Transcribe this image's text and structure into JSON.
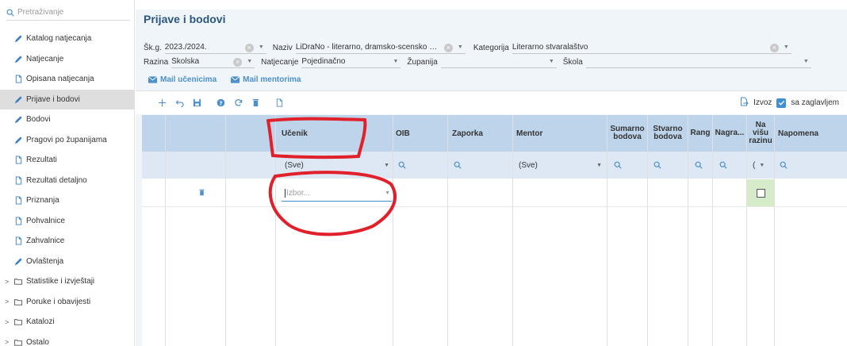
{
  "sidebar": {
    "search_placeholder": "Pretraživanje",
    "items": [
      {
        "label": "Katalog natjecanja",
        "icon": "pencil-icon"
      },
      {
        "label": "Natjecanje",
        "icon": "pencil-icon"
      },
      {
        "label": "Opisana natjecanja",
        "icon": "document-icon"
      },
      {
        "label": "Prijave i bodovi",
        "icon": "pencil-icon",
        "active": true
      },
      {
        "label": "Bodovi",
        "icon": "pencil-icon"
      },
      {
        "label": "Pragovi po županijama",
        "icon": "pencil-icon"
      },
      {
        "label": "Rezultati",
        "icon": "document-icon"
      },
      {
        "label": "Rezultati detaljno",
        "icon": "document-icon"
      },
      {
        "label": "Priznanja",
        "icon": "document-icon"
      },
      {
        "label": "Pohvalnice",
        "icon": "document-icon"
      },
      {
        "label": "Zahvalnice",
        "icon": "document-icon"
      },
      {
        "label": "Ovlaštenja",
        "icon": "pencil-icon"
      }
    ],
    "folders": [
      {
        "label": "Statistike i izvještaji"
      },
      {
        "label": "Poruke i obavijesti"
      },
      {
        "label": "Katalozi"
      },
      {
        "label": "Ostalo"
      }
    ]
  },
  "page": {
    "title": "Prijave i bodovi"
  },
  "filters": {
    "skg_label": "Šk.g.",
    "skg_value": "2023./2024.",
    "naziv_label": "Naziv",
    "naziv_value": "LiDraNo - literarno, dramsko-scensko i novi...",
    "kategorija_label": "Kategorija",
    "kategorija_value": "Literarno stvaralaštvo",
    "razina_label": "Razina",
    "razina_value": "Školska",
    "natjecanje_label": "Natjecanje",
    "natjecanje_value": "Pojedinačno",
    "zupanija_label": "Županija",
    "zupanija_value": "",
    "skola_label": "Škola",
    "skola_value": ""
  },
  "mail": {
    "students": "Mail učenicima",
    "mentors": "Mail mentorima"
  },
  "toolbar": {
    "export_label": "Izvoz",
    "headers_label": "sa zaglavljem",
    "headers_checked": true
  },
  "grid": {
    "columns": {
      "ucenik": "Učenik",
      "oib": "OIB",
      "zaporka": "Zaporka",
      "mentor": "Mentor",
      "sumarno_bodova": "Sumarno bodova",
      "stvarno_bodova": "Stvarno bodova",
      "rang": "Rang",
      "nagrada": "Nagra...",
      "na_visu_razinu": "Na višu razinu",
      "napomena": "Napomena"
    },
    "filter_row": {
      "ucenik": "(Sve)",
      "mentor": "(Sve)",
      "na_visu_razinu": "("
    },
    "new_row": {
      "ucenik_placeholder": "Izbor..."
    }
  },
  "colors": {
    "accent": "#4b8fcc",
    "title": "#2a5680",
    "header_bg": "#bed4eb",
    "filter_bg": "#dde8f4",
    "annotation": "#e0202a",
    "green_cell": "#d6ebc9"
  }
}
